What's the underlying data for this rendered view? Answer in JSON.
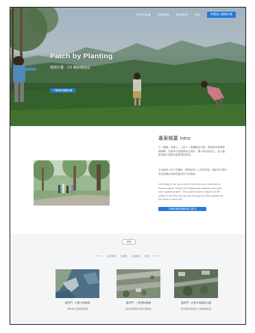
{
  "nav": {
    "items": [
      "我們的故事",
      "活動紀錄",
      "聯絡我們",
      "其他"
    ],
    "cta": "申請加入植樹計畫"
  },
  "hero": {
    "title": "Patch by Planting",
    "subtitle": "植樹計畫 - 115 種樹種植區",
    "button": "了解更多植樹計畫"
  },
  "intro": {
    "title": "專案概要 Intro",
    "paragraph1": "以「種樹」為核心，上百人一邊種樹並行動，透過城市綠帶修補策略，在都市中重建綠色生態系，讓人與自然共生，並以植栽為媒介連結社區鄰里的參與。",
    "paragraph2": "本計畫自 2020 年開始，邀請各界人士共同參與，將都市中零碎的空地轉化為綠意盎然的小型森林。",
    "paragraph3": "Just Wrap is the open code of the trees Intro collection to honour nature. What is the relationship between trees and open spaces project? The project hopes to figure out the outline of the tree and the plan through the trees planted as the future in each plot.",
    "button": "了解本案的詳細內容 (英文)"
  },
  "projects": {
    "tag": "專案",
    "filters": [
      "全部專案",
      "行道樹",
      "公園綠地",
      "校園"
    ],
    "cards": [
      {
        "title": "臺灣門 · 大里小型綠地",
        "subtitle": "海岸線公園綠帶串連"
      },
      {
        "title": "臺灣門 · 八里濕地綠廊",
        "subtitle": "都市綠帶與河岸步道串連"
      },
      {
        "title": "臺灣門 · 大安平地森林公園",
        "subtitle": "都市森林與城市公園綠帶串連"
      }
    ]
  },
  "colors": {
    "accent": "#2479d8"
  }
}
